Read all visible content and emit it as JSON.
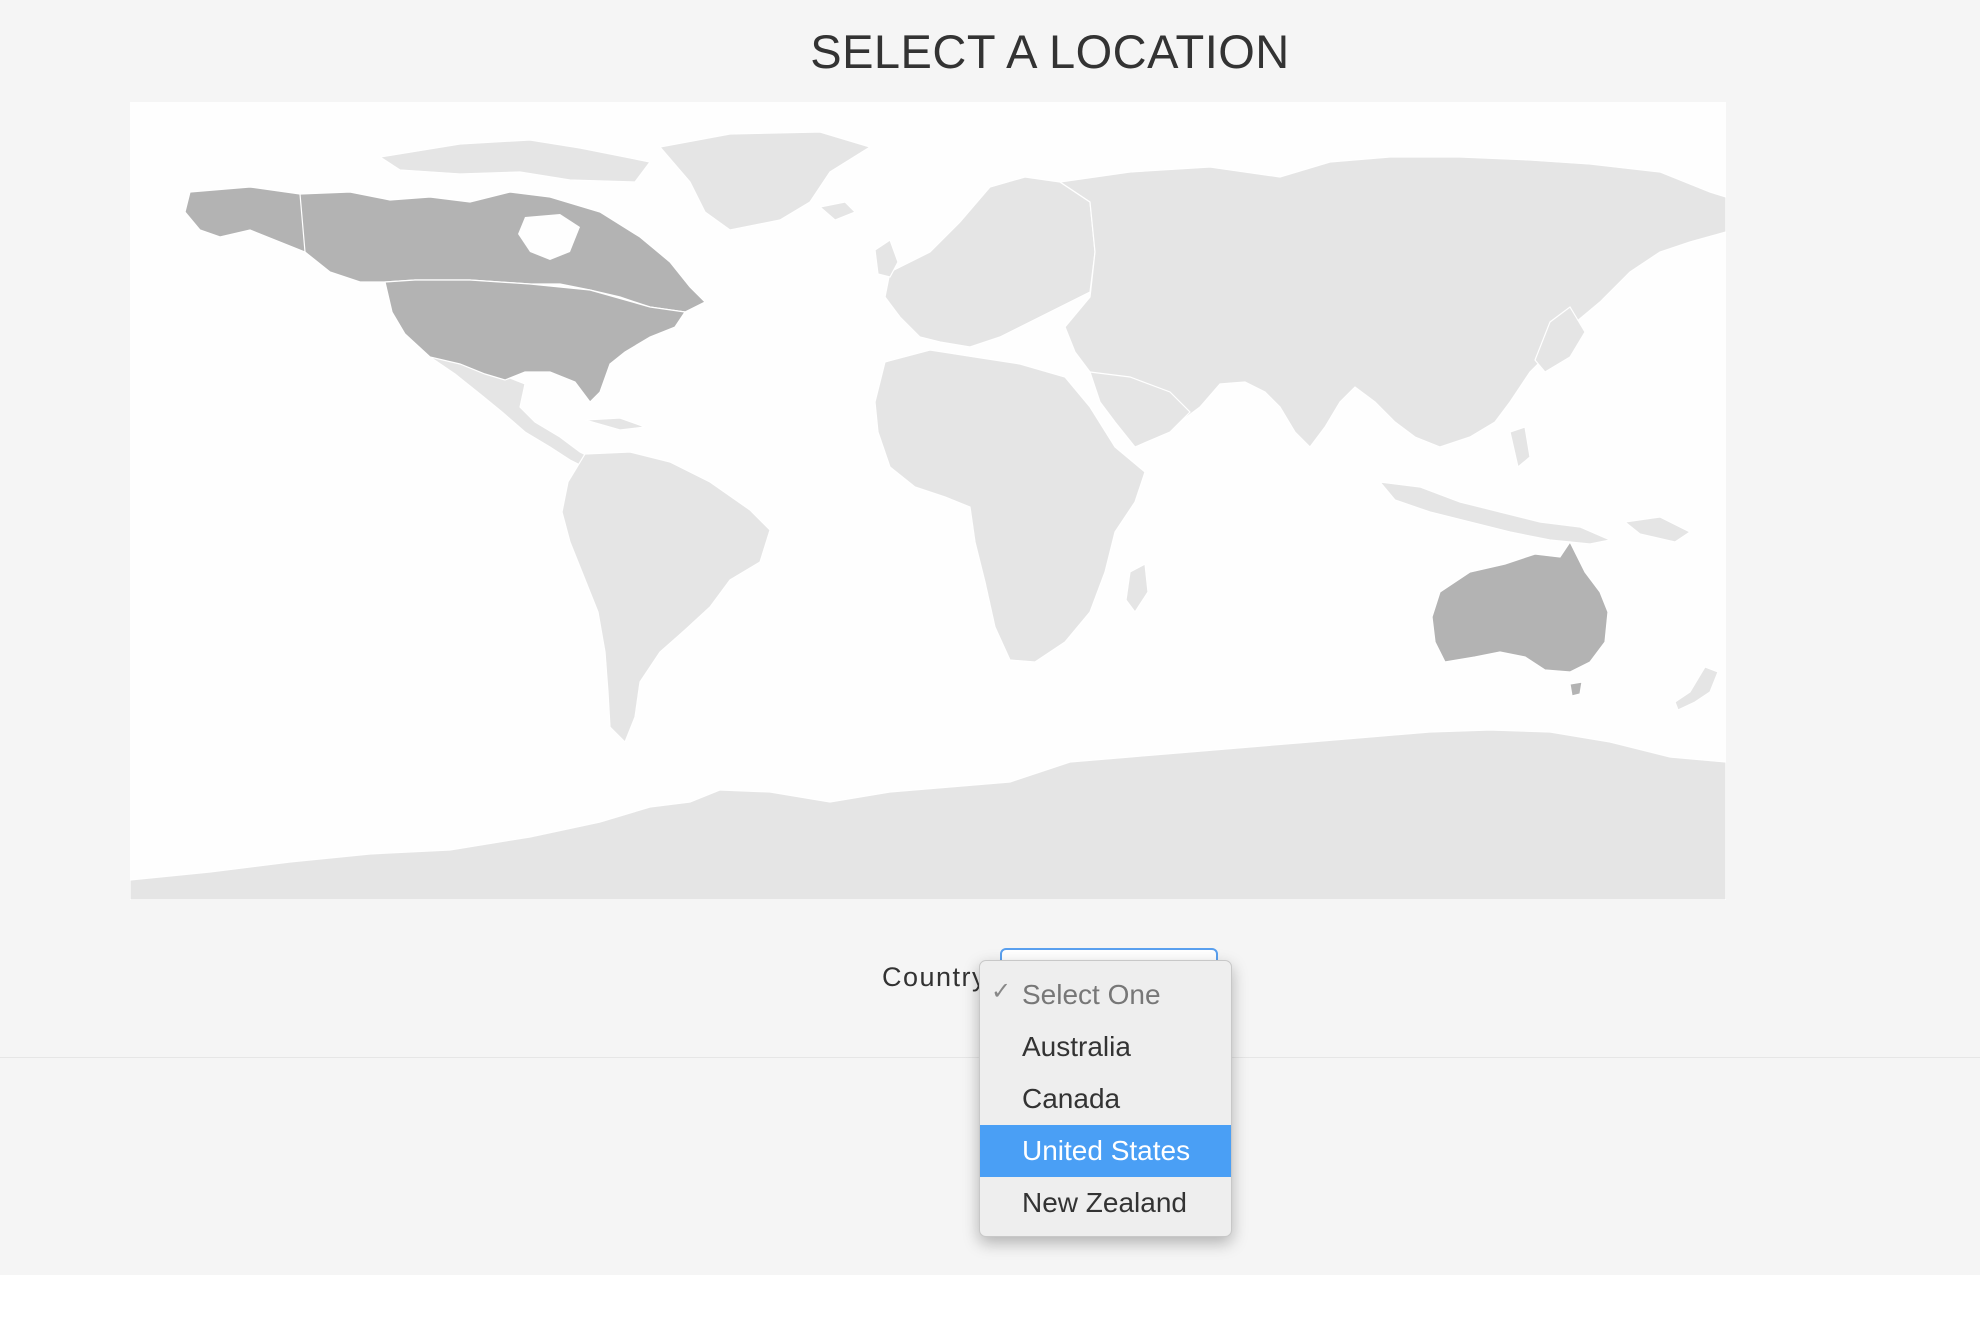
{
  "page": {
    "title": "SELECT A LOCATION"
  },
  "map": {
    "highlighted_regions": [
      "North America (Canada, United States)",
      "Australia"
    ],
    "colors": {
      "background": "#fefefe",
      "land": "#e5e5e5",
      "highlighted": "#b3b3b3",
      "border": "#ffffff"
    }
  },
  "form": {
    "country_label": "Country",
    "select": {
      "current_value": "",
      "focused": true,
      "options": [
        {
          "label": "Select One",
          "checked": true,
          "placeholder": true,
          "highlighted": false
        },
        {
          "label": "Australia",
          "checked": false,
          "placeholder": false,
          "highlighted": false
        },
        {
          "label": "Canada",
          "checked": false,
          "placeholder": false,
          "highlighted": false
        },
        {
          "label": "United States",
          "checked": false,
          "placeholder": false,
          "highlighted": true
        },
        {
          "label": "New Zealand",
          "checked": false,
          "placeholder": false,
          "highlighted": false
        }
      ],
      "check_icon": "checkmark-icon"
    }
  },
  "colors": {
    "page_background": "#f5f5f5",
    "title_text": "#333333",
    "select_focus": "#5aa0ef",
    "option_highlight": "#4a9ff5"
  }
}
